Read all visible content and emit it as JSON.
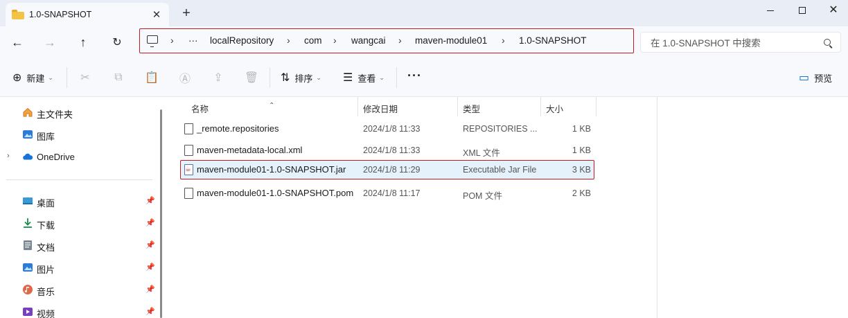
{
  "tab": {
    "title": "1.0-SNAPSHOT",
    "close": "✕",
    "new_tab": "+"
  },
  "window": {
    "close": "✕"
  },
  "nav": {
    "back": "←",
    "forward": "→",
    "up": "↑",
    "refresh": "↻"
  },
  "breadcrumb": [
    "···",
    "localRepository",
    "com",
    "wangcai",
    "maven-module01",
    "1.0-SNAPSHOT"
  ],
  "breadcrumb_sep": "›",
  "search": {
    "placeholder": "在 1.0-SNAPSHOT 中搜索"
  },
  "toolbar": {
    "new_label": "新建",
    "sort_label": "排序",
    "view_label": "查看",
    "more": "···",
    "preview_label": "预览"
  },
  "sidebar": {
    "pinned_top": [
      {
        "label": "主文件夹",
        "icon": "home-icon"
      },
      {
        "label": "图库",
        "icon": "gallery-icon"
      },
      {
        "label": "OneDrive",
        "icon": "cloud-icon"
      }
    ],
    "quick_access": [
      {
        "label": "桌面",
        "icon": "desktop-icon"
      },
      {
        "label": "下载",
        "icon": "download-icon"
      },
      {
        "label": "文档",
        "icon": "documents-icon"
      },
      {
        "label": "图片",
        "icon": "pictures-icon"
      },
      {
        "label": "音乐",
        "icon": "music-icon"
      },
      {
        "label": "视频",
        "icon": "videos-icon"
      }
    ]
  },
  "columns": {
    "name": "名称",
    "date": "修改日期",
    "type": "类型",
    "size": "大小"
  },
  "files": [
    {
      "name": "_remote.repositories",
      "date": "2024/1/8 11:33",
      "type": "REPOSITORIES ...",
      "size": "1 KB",
      "icon": "file-icon"
    },
    {
      "name": "maven-metadata-local.xml",
      "date": "2024/1/8 11:33",
      "type": "XML 文件",
      "size": "1 KB",
      "icon": "file-icon"
    },
    {
      "name": "maven-module01-1.0-SNAPSHOT.jar",
      "date": "2024/1/8 11:29",
      "type": "Executable Jar File",
      "size": "3 KB",
      "icon": "jar-file-icon"
    },
    {
      "name": "maven-module01-1.0-SNAPSHOT.pom",
      "date": "2024/1/8 11:17",
      "type": "POM 文件",
      "size": "2 KB",
      "icon": "file-icon"
    }
  ],
  "colors": {
    "highlight_outline": "#c8171f",
    "selected_row": "#e5f1fb",
    "accent": "#0067c0"
  }
}
